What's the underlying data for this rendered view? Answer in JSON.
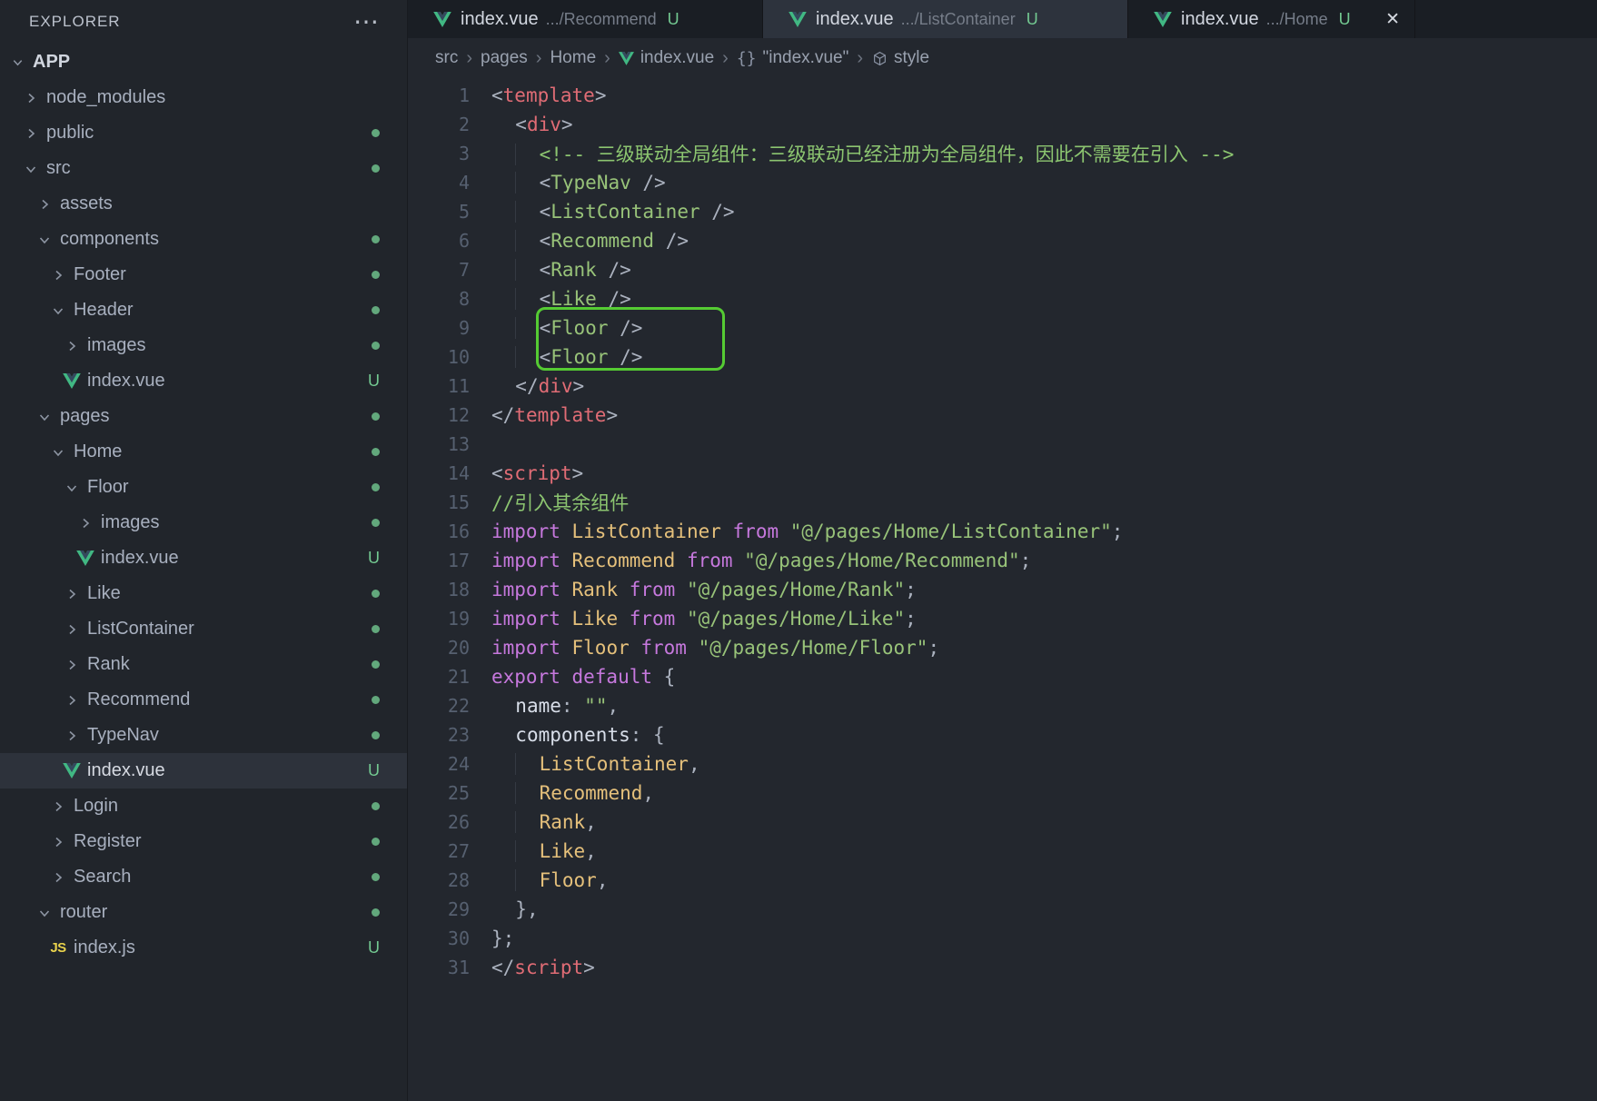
{
  "colors": {
    "editor_bg": "#23272e",
    "sidebar_bg": "#21252b",
    "tabbar_bg": "#1a1e24",
    "tab_highlight_bg": "#2d333d",
    "selected_row_bg": "#2d323b",
    "badge_green": "#73c991",
    "vue_green": "#41b883",
    "vue_dark": "#34495e",
    "js_yellow": "#e8d24c",
    "annotation_green": "#55cb33",
    "syntax_tag": "#e06c75",
    "syntax_component": "#98c379",
    "syntax_comment": "#8cc570",
    "syntax_string": "#98c379",
    "syntax_keyword": "#c678dd",
    "syntax_identifier": "#e5c07b",
    "line_number": "#566070"
  },
  "explorer": {
    "title": "EXPLORER",
    "more_glyph": "⋯",
    "section": "APP",
    "tree": [
      {
        "label": "node_modules",
        "depth": 1,
        "kind": "folder",
        "state": "collapsed",
        "badge": null
      },
      {
        "label": "public",
        "depth": 1,
        "kind": "folder",
        "state": "collapsed",
        "badge": "dot"
      },
      {
        "label": "src",
        "depth": 1,
        "kind": "folder",
        "state": "expanded",
        "badge": "dot"
      },
      {
        "label": "assets",
        "depth": 2,
        "kind": "folder",
        "state": "collapsed",
        "badge": null
      },
      {
        "label": "components",
        "depth": 2,
        "kind": "folder",
        "state": "expanded",
        "badge": "dot"
      },
      {
        "label": "Footer",
        "depth": 3,
        "kind": "folder",
        "state": "collapsed",
        "badge": "dot"
      },
      {
        "label": "Header",
        "depth": 3,
        "kind": "folder",
        "state": "expanded",
        "badge": "dot"
      },
      {
        "label": "images",
        "depth": 4,
        "kind": "folder",
        "state": "collapsed",
        "badge": "dot"
      },
      {
        "label": "index.vue",
        "depth": 4,
        "kind": "file",
        "icon": "vue",
        "badge": "U"
      },
      {
        "label": "pages",
        "depth": 2,
        "kind": "folder",
        "state": "expanded",
        "badge": "dot"
      },
      {
        "label": "Home",
        "depth": 3,
        "kind": "folder",
        "state": "expanded",
        "badge": "dot"
      },
      {
        "label": "Floor",
        "depth": 4,
        "kind": "folder",
        "state": "expanded",
        "badge": "dot"
      },
      {
        "label": "images",
        "depth": 5,
        "kind": "folder",
        "state": "collapsed",
        "badge": "dot"
      },
      {
        "label": "index.vue",
        "depth": 5,
        "kind": "file",
        "icon": "vue",
        "badge": "U"
      },
      {
        "label": "Like",
        "depth": 4,
        "kind": "folder",
        "state": "collapsed",
        "badge": "dot"
      },
      {
        "label": "ListContainer",
        "depth": 4,
        "kind": "folder",
        "state": "collapsed",
        "badge": "dot"
      },
      {
        "label": "Rank",
        "depth": 4,
        "kind": "folder",
        "state": "collapsed",
        "badge": "dot"
      },
      {
        "label": "Recommend",
        "depth": 4,
        "kind": "folder",
        "state": "collapsed",
        "badge": "dot"
      },
      {
        "label": "TypeNav",
        "depth": 4,
        "kind": "folder",
        "state": "collapsed",
        "badge": "dot"
      },
      {
        "label": "index.vue",
        "depth": 4,
        "kind": "file",
        "icon": "vue",
        "badge": "U",
        "selected": true
      },
      {
        "label": "Login",
        "depth": 3,
        "kind": "folder",
        "state": "collapsed",
        "badge": "dot"
      },
      {
        "label": "Register",
        "depth": 3,
        "kind": "folder",
        "state": "collapsed",
        "badge": "dot"
      },
      {
        "label": "Search",
        "depth": 3,
        "kind": "folder",
        "state": "collapsed",
        "badge": "dot"
      },
      {
        "label": "router",
        "depth": 2,
        "kind": "folder",
        "state": "expanded",
        "badge": "dot"
      },
      {
        "label": "index.js",
        "depth": 3,
        "kind": "file",
        "icon": "js",
        "badge": "U"
      }
    ]
  },
  "tabs": [
    {
      "title": "index.vue",
      "path": ".../Recommend",
      "git": "U",
      "icon": "vue",
      "highlighted": false,
      "close_visible": false
    },
    {
      "title": "index.vue",
      "path": ".../ListContainer",
      "git": "U",
      "icon": "vue",
      "highlighted": true,
      "close_visible": false
    },
    {
      "title": "index.vue",
      "path": ".../Home",
      "git": "U",
      "icon": "vue",
      "highlighted": false,
      "close_visible": true
    }
  ],
  "breadcrumbs": [
    {
      "label": "src",
      "icon": null
    },
    {
      "label": "pages",
      "icon": null
    },
    {
      "label": "Home",
      "icon": null
    },
    {
      "label": "index.vue",
      "icon": "vue"
    },
    {
      "label": "\"index.vue\"",
      "icon": "braces"
    },
    {
      "label": "style",
      "icon": "cube"
    }
  ],
  "editor": {
    "annotation": {
      "shape": "rounded-box",
      "lines": [
        9,
        10
      ],
      "color": "#55cb33"
    },
    "lines": [
      {
        "n": 1,
        "i": 0,
        "t": [
          [
            "pun",
            "<"
          ],
          [
            "tag",
            "template"
          ],
          [
            "pun",
            ">"
          ]
        ]
      },
      {
        "n": 2,
        "i": 1,
        "t": [
          [
            "pun",
            "<"
          ],
          [
            "tag",
            "div"
          ],
          [
            "pun",
            ">"
          ]
        ]
      },
      {
        "n": 3,
        "i": 2,
        "t": [
          [
            "com",
            "<!-- 三级联动全局组件：三级联动已经注册为全局组件，因此不需要在引入 -->"
          ]
        ]
      },
      {
        "n": 4,
        "i": 2,
        "t": [
          [
            "pun",
            "<"
          ],
          [
            "cmp",
            "TypeNav"
          ],
          [
            "pun",
            " />"
          ]
        ]
      },
      {
        "n": 5,
        "i": 2,
        "t": [
          [
            "pun",
            "<"
          ],
          [
            "cmp",
            "ListContainer"
          ],
          [
            "pun",
            " />"
          ]
        ]
      },
      {
        "n": 6,
        "i": 2,
        "t": [
          [
            "pun",
            "<"
          ],
          [
            "cmp",
            "Recommend"
          ],
          [
            "pun",
            " />"
          ]
        ]
      },
      {
        "n": 7,
        "i": 2,
        "t": [
          [
            "pun",
            "<"
          ],
          [
            "cmp",
            "Rank"
          ],
          [
            "pun",
            " />"
          ]
        ]
      },
      {
        "n": 8,
        "i": 2,
        "t": [
          [
            "pun",
            "<"
          ],
          [
            "cmp",
            "Like"
          ],
          [
            "pun",
            " />"
          ]
        ]
      },
      {
        "n": 9,
        "i": 2,
        "t": [
          [
            "pun",
            "<"
          ],
          [
            "cmp",
            "Floor"
          ],
          [
            "pun",
            " />"
          ]
        ]
      },
      {
        "n": 10,
        "i": 2,
        "t": [
          [
            "pun",
            "<"
          ],
          [
            "cmp",
            "Floor"
          ],
          [
            "pun",
            " />"
          ]
        ]
      },
      {
        "n": 11,
        "i": 1,
        "t": [
          [
            "pun",
            "</"
          ],
          [
            "tag",
            "div"
          ],
          [
            "pun",
            ">"
          ]
        ]
      },
      {
        "n": 12,
        "i": 0,
        "t": [
          [
            "pun",
            "</"
          ],
          [
            "tag",
            "template"
          ],
          [
            "pun",
            ">"
          ]
        ]
      },
      {
        "n": 13,
        "i": 0,
        "t": []
      },
      {
        "n": 14,
        "i": 0,
        "t": [
          [
            "pun",
            "<"
          ],
          [
            "tag",
            "script"
          ],
          [
            "pun",
            ">"
          ]
        ]
      },
      {
        "n": 15,
        "i": 0,
        "t": [
          [
            "com",
            "//引入其余组件"
          ]
        ]
      },
      {
        "n": 16,
        "i": 0,
        "t": [
          [
            "kw",
            "import "
          ],
          [
            "id",
            "ListContainer"
          ],
          [
            "kw",
            " from "
          ],
          [
            "str",
            "\"@/pages/Home/ListContainer\""
          ],
          [
            "pun",
            ";"
          ]
        ]
      },
      {
        "n": 17,
        "i": 0,
        "t": [
          [
            "kw",
            "import "
          ],
          [
            "id",
            "Recommend"
          ],
          [
            "kw",
            " from "
          ],
          [
            "str",
            "\"@/pages/Home/Recommend\""
          ],
          [
            "pun",
            ";"
          ]
        ]
      },
      {
        "n": 18,
        "i": 0,
        "t": [
          [
            "kw",
            "import "
          ],
          [
            "id",
            "Rank"
          ],
          [
            "kw",
            " from "
          ],
          [
            "str",
            "\"@/pages/Home/Rank\""
          ],
          [
            "pun",
            ";"
          ]
        ]
      },
      {
        "n": 19,
        "i": 0,
        "t": [
          [
            "kw",
            "import "
          ],
          [
            "id",
            "Like"
          ],
          [
            "kw",
            " from "
          ],
          [
            "str",
            "\"@/pages/Home/Like\""
          ],
          [
            "pun",
            ";"
          ]
        ]
      },
      {
        "n": 20,
        "i": 0,
        "t": [
          [
            "kw",
            "import "
          ],
          [
            "id",
            "Floor"
          ],
          [
            "kw",
            " from "
          ],
          [
            "str",
            "\"@/pages/Home/Floor\""
          ],
          [
            "pun",
            ";"
          ]
        ]
      },
      {
        "n": 21,
        "i": 0,
        "t": [
          [
            "kw",
            "export default "
          ],
          [
            "pun",
            "{"
          ]
        ]
      },
      {
        "n": 22,
        "i": 1,
        "t": [
          [
            "key",
            "name"
          ],
          [
            "pun",
            ": "
          ],
          [
            "str",
            "\"\""
          ],
          [
            "pun",
            ","
          ]
        ]
      },
      {
        "n": 23,
        "i": 1,
        "t": [
          [
            "key",
            "components"
          ],
          [
            "pun",
            ": {"
          ]
        ]
      },
      {
        "n": 24,
        "i": 2,
        "t": [
          [
            "id",
            "ListContainer"
          ],
          [
            "pun",
            ","
          ]
        ]
      },
      {
        "n": 25,
        "i": 2,
        "t": [
          [
            "id",
            "Recommend"
          ],
          [
            "pun",
            ","
          ]
        ]
      },
      {
        "n": 26,
        "i": 2,
        "t": [
          [
            "id",
            "Rank"
          ],
          [
            "pun",
            ","
          ]
        ]
      },
      {
        "n": 27,
        "i": 2,
        "t": [
          [
            "id",
            "Like"
          ],
          [
            "pun",
            ","
          ]
        ]
      },
      {
        "n": 28,
        "i": 2,
        "t": [
          [
            "id",
            "Floor"
          ],
          [
            "pun",
            ","
          ]
        ]
      },
      {
        "n": 29,
        "i": 1,
        "t": [
          [
            "pun",
            "},"
          ]
        ]
      },
      {
        "n": 30,
        "i": 0,
        "t": [
          [
            "pun",
            "};"
          ]
        ]
      },
      {
        "n": 31,
        "i": 0,
        "t": [
          [
            "pun",
            "</"
          ],
          [
            "tag",
            "script"
          ],
          [
            "pun",
            ">"
          ]
        ]
      }
    ]
  }
}
